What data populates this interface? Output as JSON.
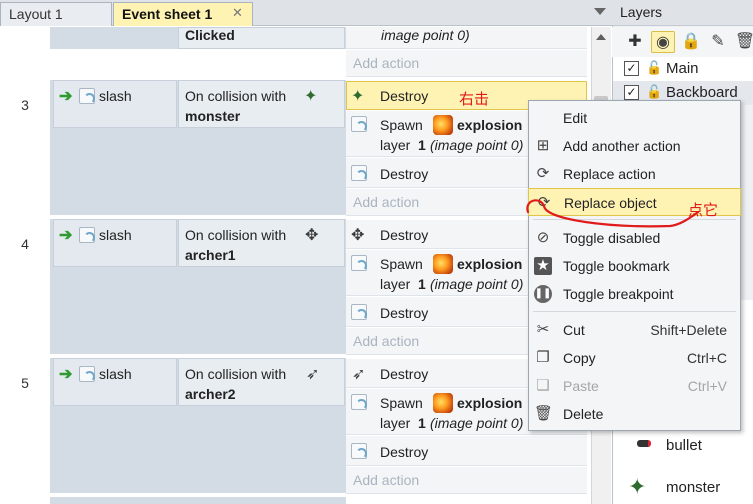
{
  "tabs": [
    {
      "label": "Layout 1",
      "active": false
    },
    {
      "label": "Event sheet 1",
      "active": true
    }
  ],
  "tab_close_glyph": "✕",
  "sheet": {
    "top_partial": {
      "condition_text": "Clicked",
      "action_text": "image point 0)",
      "add_action": "Add action"
    },
    "events": [
      {
        "number": "3",
        "trigger": "slash",
        "condition_prefix": "On collision with",
        "condition_object": "monster",
        "actions": [
          {
            "text": "Destroy",
            "icon": "monster-sprite-icon"
          },
          {
            "spawn": "Spawn",
            "object": "explosion",
            "layer_label": "layer",
            "layer_value": "1",
            "point": "(image point 0)"
          },
          {
            "text": "Destroy",
            "icon": "slash-icon"
          }
        ],
        "add_action": "Add action"
      },
      {
        "number": "4",
        "trigger": "slash",
        "condition_prefix": "On collision with",
        "condition_object": "archer1",
        "actions": [
          {
            "text": "Destroy",
            "icon": "archer-sprite-icon"
          },
          {
            "spawn": "Spawn",
            "object": "explosion",
            "layer_label": "layer",
            "layer_value": "1",
            "point": "(image point 0)"
          },
          {
            "text": "Destroy",
            "icon": "slash-icon"
          }
        ],
        "add_action": "Add action"
      },
      {
        "number": "5",
        "trigger": "slash",
        "condition_prefix": "On collision with",
        "condition_object": "archer2",
        "actions": [
          {
            "text": "Destroy",
            "icon": "archer2-sprite-icon"
          },
          {
            "spawn": "Spawn",
            "object": "explosion",
            "layer_label": "layer",
            "layer_value": "1",
            "point": "(image point 0)"
          },
          {
            "text": "Destroy",
            "icon": "slash-icon"
          }
        ],
        "add_action": "Add action"
      }
    ]
  },
  "annotations": {
    "right_click": "右击",
    "click_it": "点它"
  },
  "context_menu": {
    "items": [
      {
        "label": "Edit",
        "icon": "",
        "shortcut": ""
      },
      {
        "label": "Add another action",
        "icon": "add-action-icon",
        "shortcut": ""
      },
      {
        "label": "Replace action",
        "icon": "replace-action-icon",
        "shortcut": ""
      },
      {
        "label": "Replace object",
        "icon": "replace-object-icon",
        "shortcut": "",
        "highlighted": true
      },
      {
        "label": "Toggle disabled",
        "icon": "disabled-icon",
        "shortcut": ""
      },
      {
        "label": "Toggle bookmark",
        "icon": "bookmark-star-icon",
        "shortcut": ""
      },
      {
        "label": "Toggle breakpoint",
        "icon": "pause-icon",
        "shortcut": ""
      },
      {
        "label": "Cut",
        "icon": "scissors-icon",
        "shortcut": "Shift+Delete"
      },
      {
        "label": "Copy",
        "icon": "copy-icon",
        "shortcut": "Ctrl+C"
      },
      {
        "label": "Paste",
        "icon": "paste-icon",
        "shortcut": "Ctrl+V",
        "disabled": true
      },
      {
        "label": "Delete",
        "icon": "trash-icon",
        "shortcut": ""
      }
    ]
  },
  "layers_panel": {
    "title": "Layers",
    "toolbar": [
      "add-icon",
      "eye-icon",
      "lock-icon",
      "pencil-icon",
      "trash-icon"
    ],
    "layers": [
      {
        "name": "Main",
        "checked": true
      },
      {
        "name": "Backboard",
        "checked": true
      }
    ]
  },
  "objects_panel": {
    "items": [
      {
        "name": "bullet",
        "icon": "bullet-icon"
      },
      {
        "name": "monster",
        "icon": "monster-sprite-icon"
      }
    ]
  },
  "colors": {
    "highlight": "#fff3b4",
    "annotation": "#e01b1b",
    "arrow_green": "#2f9a2f"
  }
}
